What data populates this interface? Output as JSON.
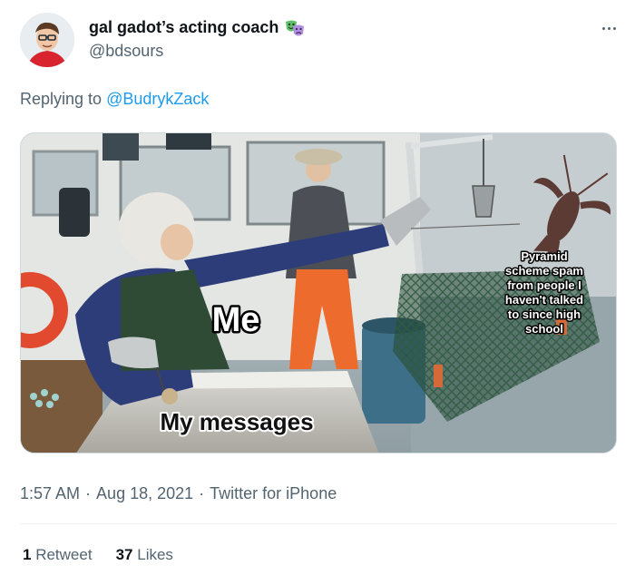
{
  "tweet": {
    "author": {
      "display_name": "gal gadot’s acting coach",
      "handle": "@bdsours",
      "emoji_icon": "performing-arts-masks-icon"
    },
    "reply_prefix": "Replying to",
    "reply_to": "@BudrykZack",
    "image": {
      "caption_me": "Me",
      "caption_messages": "My messages",
      "caption_lobster_lines": [
        "Pyramid",
        "scheme spam",
        "from people I",
        "haven't talked",
        "to since high",
        "school"
      ]
    },
    "time": "1:57 AM",
    "date": "Aug 18, 2021",
    "separator": "·",
    "source": "Twitter for iPhone",
    "stats": {
      "retweets_count": "1",
      "retweets_label": "Retweet",
      "likes_count": "37",
      "likes_label": "Likes"
    }
  },
  "colors": {
    "text_primary": "#0f1419",
    "text_secondary": "#536471",
    "link": "#1d9bf0",
    "divider": "#eff3f4"
  }
}
